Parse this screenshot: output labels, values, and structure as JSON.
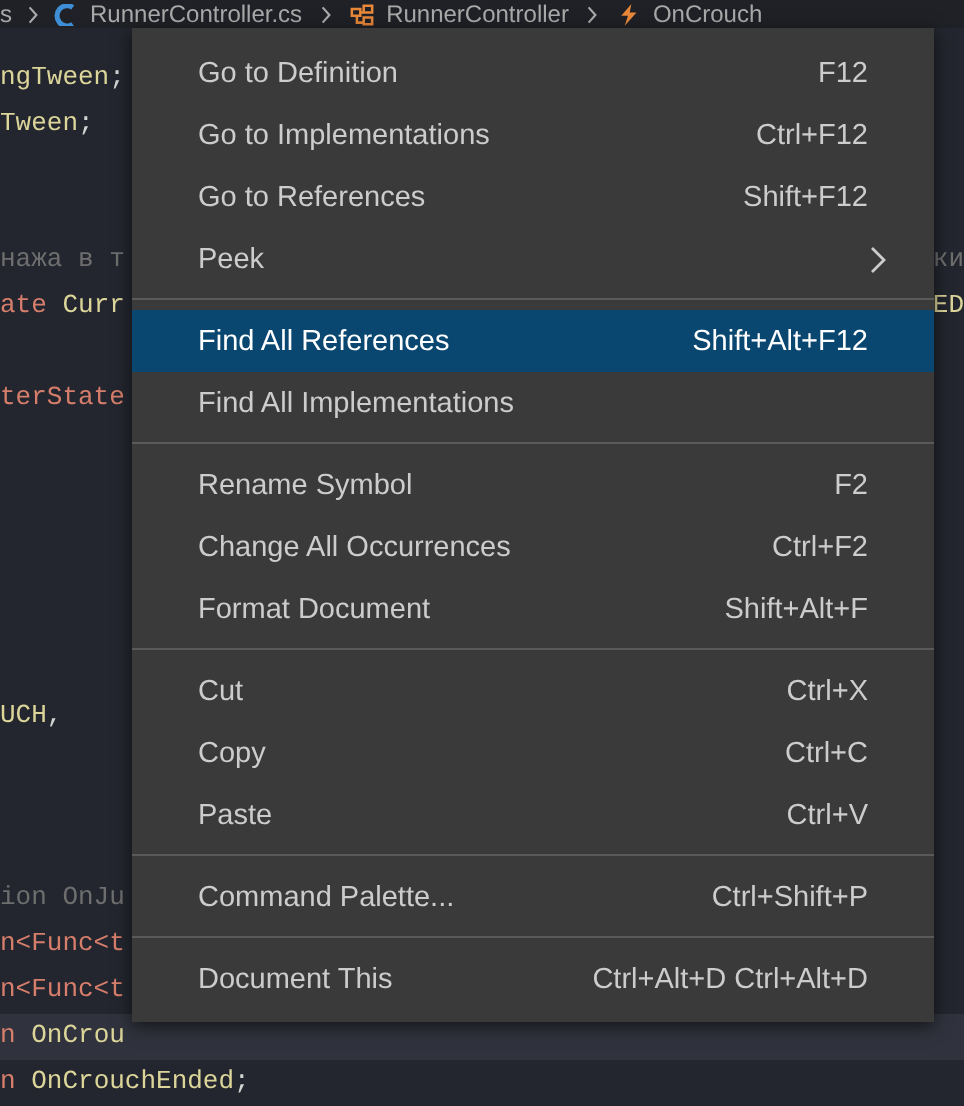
{
  "breadcrumb": [
    {
      "kind": "text",
      "label": "s"
    },
    {
      "kind": "csharp",
      "label": "RunnerController.cs"
    },
    {
      "kind": "class",
      "label": "RunnerController"
    },
    {
      "kind": "event",
      "label": "OnCrouch"
    }
  ],
  "code_lines": [
    {
      "segments": [
        {
          "kind": "ident",
          "text": "ngTween"
        },
        {
          "kind": "plain",
          "text": ";"
        }
      ],
      "current": false
    },
    {
      "segments": [
        {
          "kind": "ident",
          "text": "Tween"
        },
        {
          "kind": "plain",
          "text": ";"
        }
      ],
      "current": false
    },
    {
      "segments": [
        {
          "kind": "comment",
          "text": "нажа в т"
        }
      ],
      "tail": [
        {
          "kind": "comment",
          "text": "ки"
        }
      ],
      "current": false
    },
    {
      "segments": [
        {
          "kind": "type",
          "text": "ate "
        },
        {
          "kind": "ident",
          "text": "Curr"
        }
      ],
      "tail": [
        {
          "kind": "ident",
          "text": "ED"
        }
      ],
      "current": false
    },
    {
      "segments": [
        {
          "kind": "type",
          "text": "terState"
        }
      ],
      "current": false
    },
    {
      "segments": [
        {
          "kind": "ident",
          "text": "UCH"
        },
        {
          "kind": "plain",
          "text": ","
        }
      ],
      "current": false
    },
    {
      "segments": [
        {
          "kind": "comment",
          "text": "ion OnJu"
        }
      ],
      "current": false
    },
    {
      "segments": [
        {
          "kind": "type",
          "text": "n<Func<t"
        }
      ],
      "current": false
    },
    {
      "segments": [
        {
          "kind": "type",
          "text": "n<Func<t"
        }
      ],
      "current": false
    },
    {
      "segments": [
        {
          "kind": "type",
          "text": "n "
        },
        {
          "kind": "ident",
          "text": "OnCrou"
        }
      ],
      "current": true
    },
    {
      "segments": [
        {
          "kind": "type",
          "text": "n "
        },
        {
          "kind": "ident",
          "text": "OnCrouchEnded"
        },
        {
          "kind": "plain",
          "text": ";"
        }
      ],
      "current": false
    }
  ],
  "context_menu": {
    "groups": [
      [
        {
          "label": "Go to Definition",
          "shortcut": "F12",
          "selected": false,
          "submenu": false
        },
        {
          "label": "Go to Implementations",
          "shortcut": "Ctrl+F12",
          "selected": false,
          "submenu": false
        },
        {
          "label": "Go to References",
          "shortcut": "Shift+F12",
          "selected": false,
          "submenu": false
        },
        {
          "label": "Peek",
          "selected": false,
          "submenu": true
        }
      ],
      [
        {
          "label": "Find All References",
          "shortcut": "Shift+Alt+F12",
          "selected": true,
          "submenu": false
        },
        {
          "label": "Find All Implementations",
          "selected": false,
          "submenu": false
        }
      ],
      [
        {
          "label": "Rename Symbol",
          "shortcut": "F2",
          "selected": false,
          "submenu": false
        },
        {
          "label": "Change All Occurrences",
          "shortcut": "Ctrl+F2",
          "selected": false,
          "submenu": false
        },
        {
          "label": "Format Document",
          "shortcut": "Shift+Alt+F",
          "selected": false,
          "submenu": false
        }
      ],
      [
        {
          "label": "Cut",
          "shortcut": "Ctrl+X",
          "selected": false,
          "submenu": false
        },
        {
          "label": "Copy",
          "shortcut": "Ctrl+C",
          "selected": false,
          "submenu": false
        },
        {
          "label": "Paste",
          "shortcut": "Ctrl+V",
          "selected": false,
          "submenu": false
        }
      ],
      [
        {
          "label": "Command Palette...",
          "shortcut": "Ctrl+Shift+P",
          "selected": false,
          "submenu": false
        }
      ],
      [
        {
          "label": "Document This",
          "shortcut": "Ctrl+Alt+D Ctrl+Alt+D",
          "selected": false,
          "submenu": false
        }
      ]
    ]
  }
}
